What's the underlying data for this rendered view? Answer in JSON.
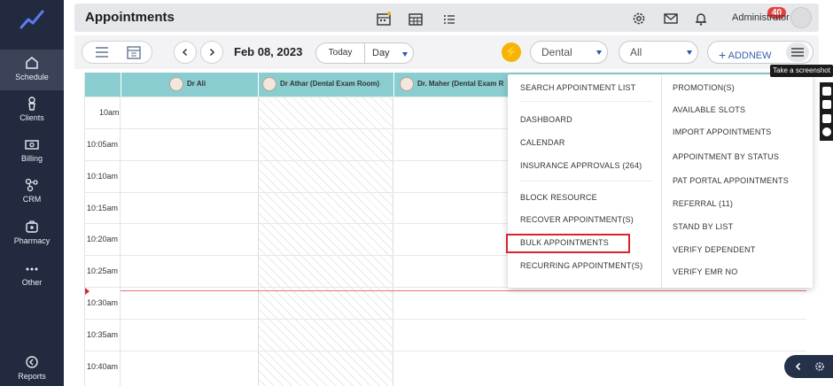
{
  "sidebar": {
    "items": [
      {
        "label": "Schedule"
      },
      {
        "label": "Clients"
      },
      {
        "label": "Billing"
      },
      {
        "label": "CRM"
      },
      {
        "label": "Pharmacy"
      },
      {
        "label": "Other"
      },
      {
        "label": "Reports"
      }
    ]
  },
  "header": {
    "title": "Appointments",
    "notification_count": "40",
    "user_name": "Administrator"
  },
  "toolbar": {
    "date": "Feb 08, 2023",
    "today_label": "Today",
    "view_value": "Day",
    "department_value": "Dental",
    "filter_value": "All",
    "add_new_label": "ADDNEW",
    "tooltip": "Take a screenshot"
  },
  "calendar": {
    "resources": [
      {
        "name": "Dr Ali"
      },
      {
        "name": "Dr Athar (Dental Exam Room)"
      },
      {
        "name": "Dr. Maher (Dental Exam R"
      }
    ],
    "times": [
      "10am",
      "10:05am",
      "10:10am",
      "10:15am",
      "10:20am",
      "10:25am",
      "10:30am",
      "10:35am",
      "10:40am"
    ]
  },
  "menu": {
    "left": [
      "SEARCH APPOINTMENT LIST",
      "DASHBOARD",
      "CALENDAR",
      "INSURANCE APPROVALS (264)",
      "BLOCK RESOURCE",
      "RECOVER APPOINTMENT(S)",
      "BULK APPOINTMENTS",
      "RECURRING APPOINTMENT(S)"
    ],
    "right": [
      "PROMOTION(S)",
      "AVAILABLE SLOTS",
      "IMPORT APPOINTMENTS",
      "APPOINTMENT BY STATUS",
      "PAT PORTAL APPOINTMENTS",
      "REFERRAL (11)",
      "STAND BY LIST",
      "VERIFY DEPENDENT",
      "VERIFY EMR NO"
    ]
  },
  "colors": {
    "sidebar": "#212a3f",
    "header_row": "#89cdd0",
    "badge": "#e6403c",
    "highlight": "#d9242a",
    "accent": "#f6b400"
  }
}
